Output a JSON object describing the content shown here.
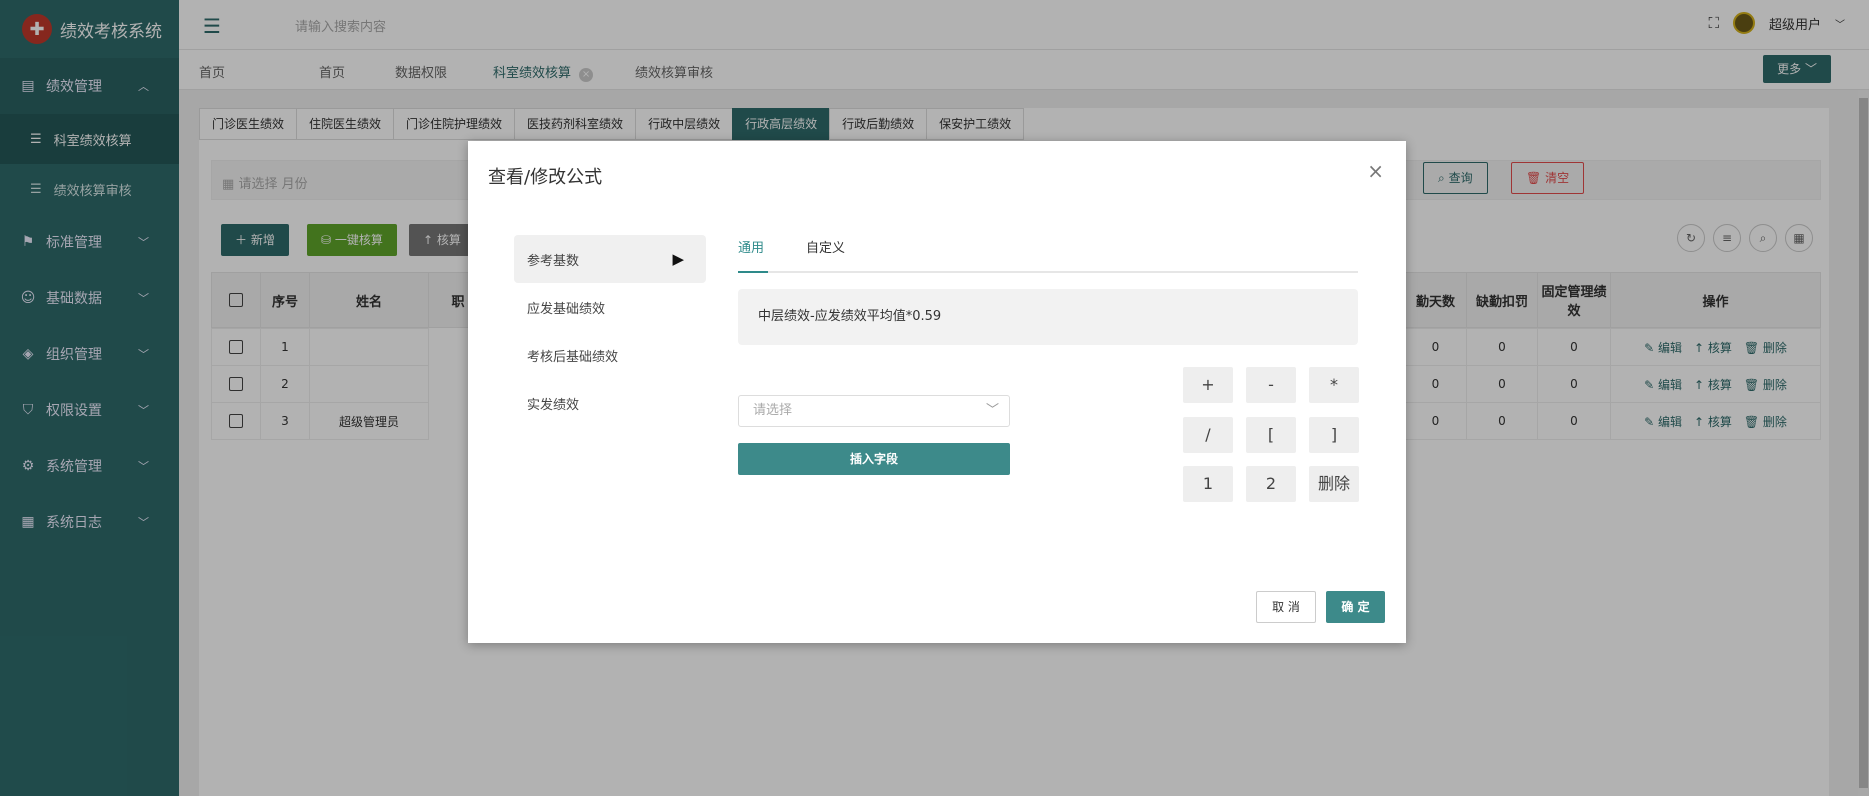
{
  "app": {
    "title": "绩效考核系统"
  },
  "sidebar": {
    "items": [
      {
        "label": "绩效管理",
        "icon": "file-icon"
      },
      {
        "label": "科室绩效核算",
        "sub": true
      },
      {
        "label": "绩效核算审核",
        "sub": true
      },
      {
        "label": "标准管理",
        "icon": "flag-icon"
      },
      {
        "label": "基础数据",
        "icon": "user-icon"
      },
      {
        "label": "组织管理",
        "icon": "tag-icon"
      },
      {
        "label": "权限设置",
        "icon": "shield-icon"
      },
      {
        "label": "系统管理",
        "icon": "gear-icon"
      },
      {
        "label": "系统日志",
        "icon": "log-icon"
      }
    ]
  },
  "topbar": {
    "search_placeholder": "请输入搜索内容",
    "user": "超级用户"
  },
  "tags": [
    "首页",
    "首页",
    "数据权限",
    "科室绩效核算",
    "绩效核算审核"
  ],
  "more": "更多",
  "subtabs": [
    "门诊医生绩效",
    "住院医生绩效",
    "门诊住院护理绩效",
    "医技药剂科室绩效",
    "行政中层绩效",
    "行政高层绩效",
    "行政后勤绩效",
    "保安护工绩效"
  ],
  "filter": {
    "date_placeholder": "请选择 月份",
    "query": "查询",
    "clear": "清空"
  },
  "toolbar": {
    "add": "新增",
    "one_key": "一键核算",
    "check": "核算"
  },
  "table": {
    "headers": {
      "seq": "序号",
      "name": "姓名",
      "col3": "职",
      "days": "勤天数",
      "deduct": "缺勤扣罚",
      "fixed": "固定管理绩效",
      "ops": "操作"
    },
    "rows": [
      {
        "seq": "1",
        "name": "",
        "days": "0",
        "deduct": "0",
        "fixed": "0"
      },
      {
        "seq": "2",
        "name": "",
        "days": "0",
        "deduct": "0",
        "fixed": "0"
      },
      {
        "seq": "3",
        "name": "超级管理员",
        "days": "0",
        "deduct": "0",
        "fixed": "0"
      }
    ],
    "ops": {
      "edit": "编辑",
      "check": "核算",
      "delete": "删除"
    }
  },
  "dialog": {
    "title": "查看/修改公式",
    "left": [
      "参考基数",
      "应发基础绩效",
      "考核后基础绩效",
      "实发绩效"
    ],
    "tabs": [
      "通用",
      "自定义"
    ],
    "formula": "中层绩效-应发绩效平均值*0.59",
    "select_placeholder": "请选择",
    "insert": "插入字段",
    "keys": [
      "+",
      "-",
      "*",
      "/",
      "[",
      "]",
      "1",
      "2",
      "删除"
    ],
    "cancel": "取 消",
    "ok": "确 定"
  },
  "colors": {
    "accent": "#2e6b6b",
    "green": "#5fa52a",
    "danger": "#e44d4d"
  }
}
